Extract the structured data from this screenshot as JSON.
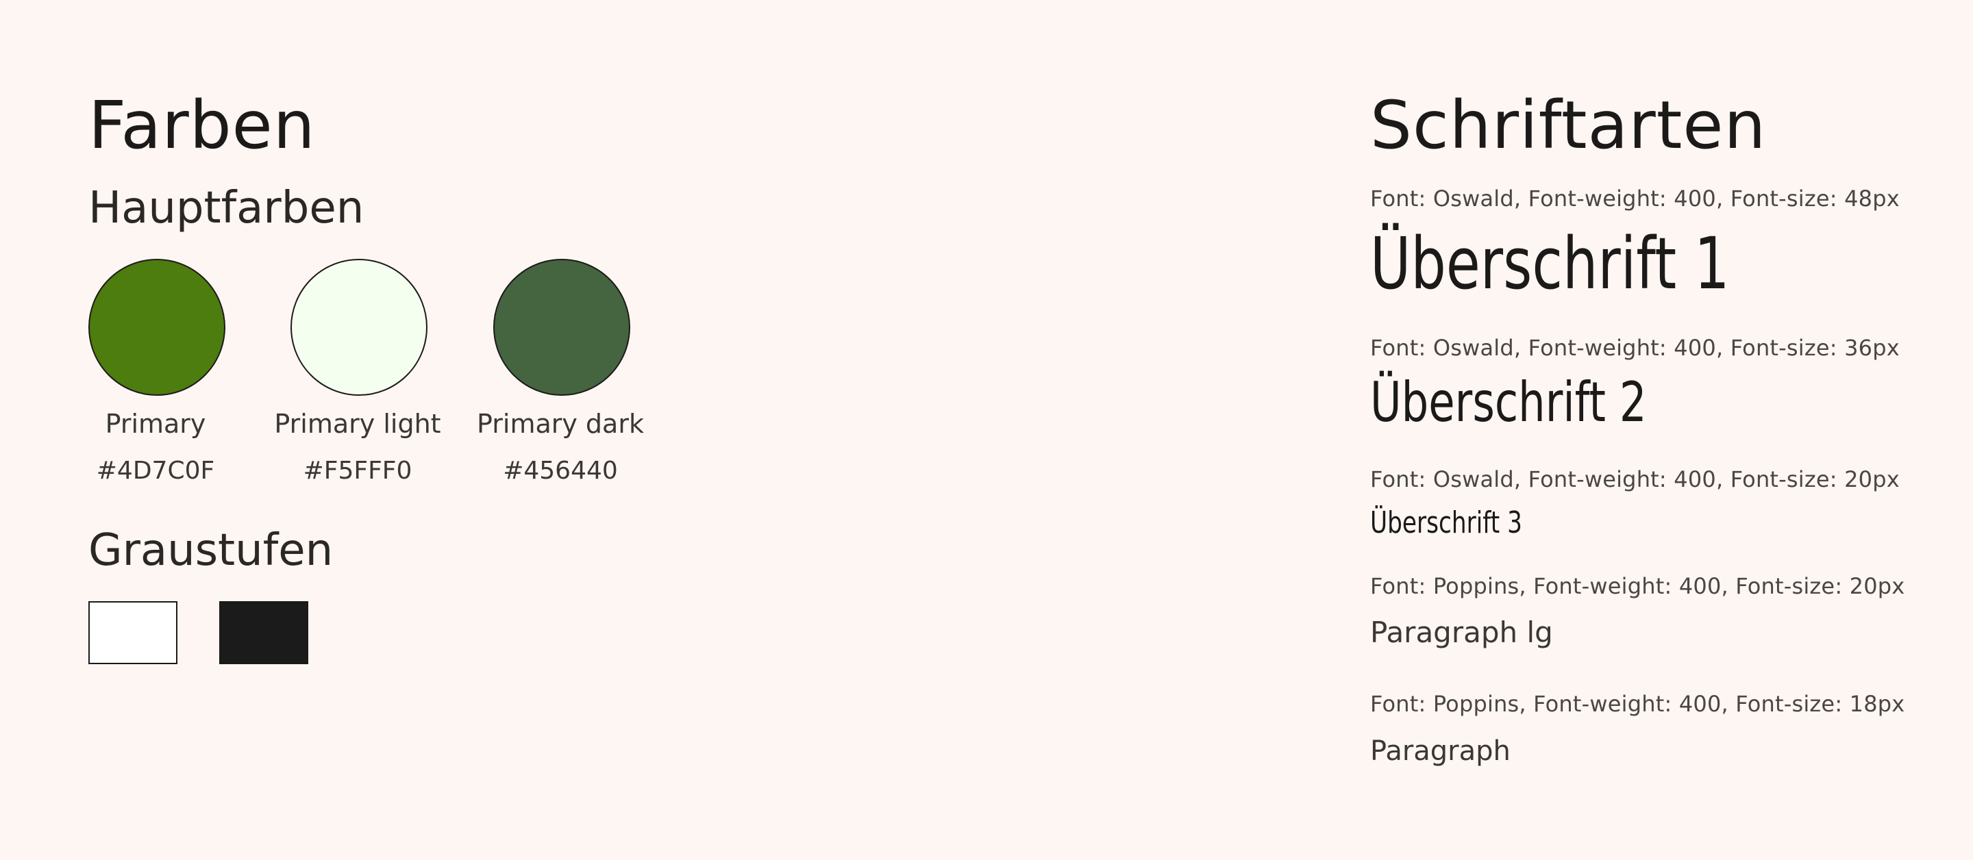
{
  "colors_section": {
    "title": "Farben",
    "main_colors_heading": "Hauptfarben",
    "swatches": [
      {
        "name": "Primary",
        "hex": "#4D7C0F",
        "color": "#4D7C0F"
      },
      {
        "name": "Primary light",
        "hex": "#F5FFF0",
        "color": "#F5FFF0"
      },
      {
        "name": "Primary dark",
        "hex": "#456440",
        "color": "#456440"
      }
    ],
    "grays_heading": "Graustufen",
    "grays": [
      {
        "color": "#FFFFFF"
      },
      {
        "color": "#1C1B1B"
      }
    ]
  },
  "fonts_section": {
    "title": "Schriftarten",
    "items": [
      {
        "spec": "Font: Oswald, Font-weight: 400, Font-size: 48px",
        "sample": "Überschrift 1"
      },
      {
        "spec": "Font: Oswald, Font-weight: 400, Font-size: 36px",
        "sample": "Überschrift 2"
      },
      {
        "spec": "Font: Oswald, Font-weight: 400, Font-size: 20px",
        "sample": "Überschrift 3"
      },
      {
        "spec": "Font: Poppins, Font-weight: 400, Font-size: 20px",
        "sample": "Paragraph lg"
      },
      {
        "spec": "Font: Poppins, Font-weight: 400, Font-size: 18px",
        "sample": "Paragraph"
      }
    ]
  },
  "page_background": "#FDF6F3"
}
